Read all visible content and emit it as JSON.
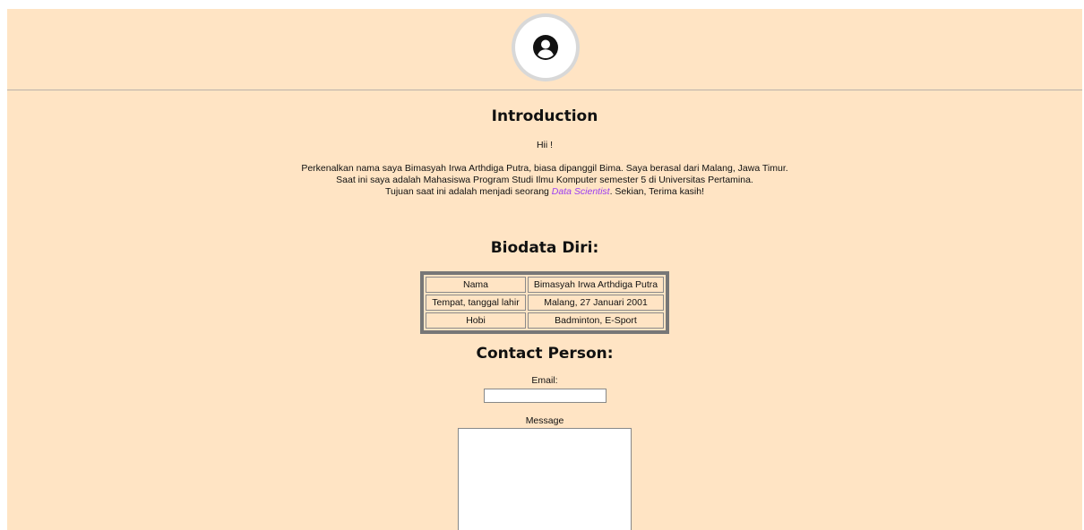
{
  "header": {
    "avatar_icon": "user-circle-icon"
  },
  "intro": {
    "title": "Introduction",
    "greeting": "Hii !",
    "line1": "Perkenalkan nama saya Bimasyah Irwa Arthdiga Putra, biasa dipanggil Bima. Saya berasal dari Malang, Jawa Timur.",
    "line2": "Saat ini saya adalah Mahasiswa Program Studi Ilmu Komputer semester 5 di Universitas Pertamina.",
    "line3_prefix": "Tujuan saat ini adalah menjadi seorang ",
    "line3_link": "Data Scientist",
    "line3_suffix": ". Sekian, Terima kasih!"
  },
  "biodata": {
    "title": "Biodata Diri:",
    "rows": [
      {
        "label": "Nama",
        "value": "Bimasyah Irwa Arthdiga Putra"
      },
      {
        "label": "Tempat, tanggal lahir",
        "value": "Malang, 27 Januari 2001"
      },
      {
        "label": "Hobi",
        "value": "Badminton, E-Sport"
      }
    ]
  },
  "contact": {
    "title": "Contact Person:",
    "email_label": "Email:",
    "email_value": "",
    "message_label": "Message",
    "message_value": ""
  },
  "colors": {
    "page_background": "#ffe4c4",
    "link": "#9b3df0"
  }
}
